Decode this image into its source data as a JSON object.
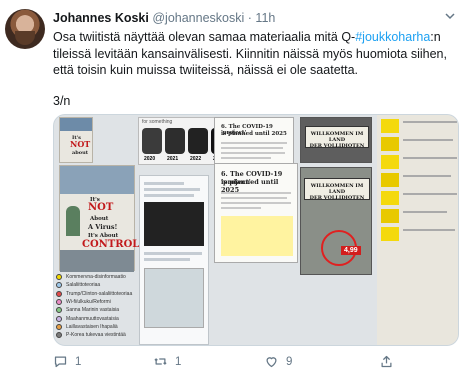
{
  "tweet": {
    "author_name": "Johannes Koski",
    "author_handle": "@johanneskoski",
    "separator": "·",
    "time": "11h",
    "text_before_hashtag": "Osa twiitistä näyttää olevan samaa materiaalia mitä Q-",
    "hashtag": "#joukkoharha",
    "text_after_hashtag": ":n tileissä levitään kansainvälisesti. Kiinnitin näissä myös huomiota siihen, että toisin kuin muissa twiiteissä, näissä ei ole saatetta.",
    "thread_counter": "3/n"
  },
  "media": {
    "posters": {
      "small_lines": [
        "It's",
        "NOT",
        "about"
      ],
      "big_lines": [
        "It's",
        "NOT",
        "About",
        "A Virus!",
        "It's About",
        "CONTROL"
      ]
    },
    "faces_header": "for something",
    "years": [
      "2020",
      "2021",
      "2022",
      "2023"
    ],
    "docs": [
      {
        "title_line1": "6. The COVID-19 'project'",
        "title_line2": "is planned until 2025"
      },
      {
        "title_line1": "6. The COVID-19 'project'",
        "title_line2": "is planned until 2025"
      }
    ],
    "sign_lines": [
      "WILLKOMMEN IM LAND",
      "DER VOLLIDIOTEN"
    ],
    "sign_lines_2": [
      "WILLKOMMEN IM LAND",
      "DER VOLLIDIOTEN"
    ],
    "price": "4,99",
    "legend": [
      {
        "color": "#f1d800",
        "label": "Kommervna-disinformaatio"
      },
      {
        "color": "#9dc8ea",
        "label": "Salaliittoteoriaa"
      },
      {
        "color": "#e04b4b",
        "label": "Trump/Clinton-salaliittoteoriaa"
      },
      {
        "color": "#e98bc4",
        "label": "Wi-fi/ulkuku/Reformi"
      },
      {
        "color": "#84c784",
        "label": "Sanna Marinin vastaisia"
      },
      {
        "color": "#c9b3e6",
        "label": "Maahanmuuttovastaisia"
      },
      {
        "color": "#e59f46",
        "label": "Laillavastaisen Ihapaliä"
      },
      {
        "color": "#7a7a7a",
        "label": "P-Korea tukevaa viestintää"
      }
    ]
  },
  "actions": {
    "reply_count": "1",
    "retweet_count": "1",
    "like_count": "9"
  },
  "colors": {
    "link": "#1da1f2",
    "muted": "#657786",
    "text": "#14171a"
  },
  "icons": [
    "caret-down-icon",
    "reply-icon",
    "retweet-icon",
    "like-icon",
    "share-icon"
  ]
}
